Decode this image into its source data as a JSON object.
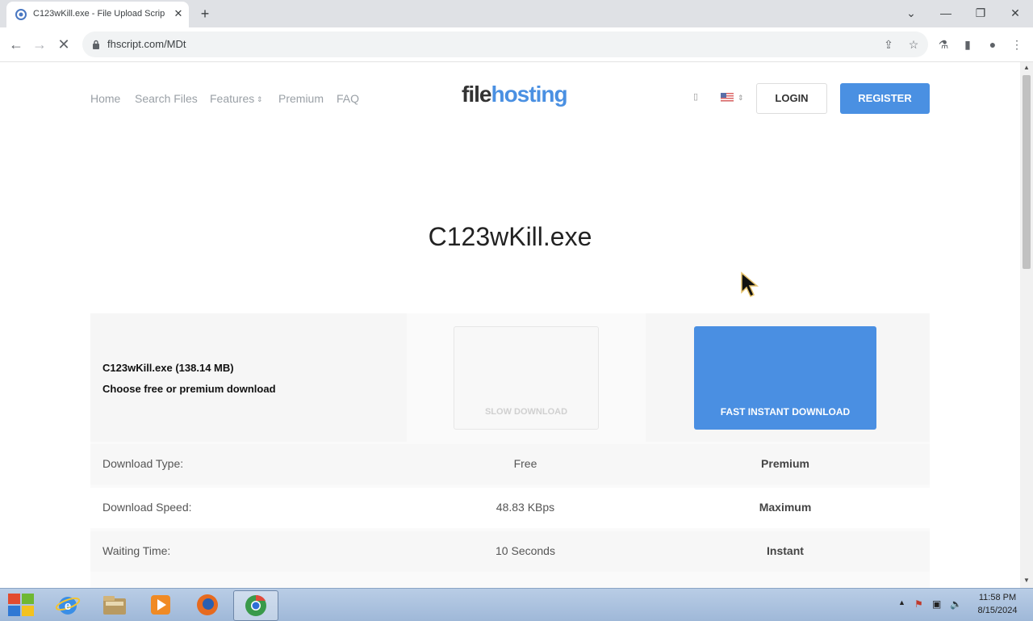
{
  "browser": {
    "tab_title": "C123wKill.exe - File Upload Script",
    "tab_close": "✕",
    "new_tab": "+",
    "url": "fhscript.com/MDt",
    "window_controls": {
      "dropdown": "⌄",
      "minimize": "—",
      "restore": "❐",
      "close": "✕"
    }
  },
  "site": {
    "nav": [
      "Home",
      "Search Files",
      "Features",
      "Premium",
      "FAQ"
    ],
    "logo_part1": "file",
    "logo_part2": "hosting",
    "login": "LOGIN",
    "register": "REGISTER",
    "brand_color": "#4a90e2"
  },
  "file": {
    "title": "C123wKill.exe",
    "name_size": "C123wKill.exe (138.14 MB)",
    "choose": "Choose free or premium download",
    "slow_download": "SLOW DOWNLOAD",
    "fast_download": "FAST INSTANT DOWNLOAD"
  },
  "table": {
    "rows": [
      {
        "label": "Download Type:",
        "free": "Free",
        "premium": "Premium"
      },
      {
        "label": "Download Speed:",
        "free": "48.83 KBps",
        "premium": "Maximum"
      },
      {
        "label": "Waiting Time:",
        "free": "10 Seconds",
        "premium": "Instant"
      }
    ]
  },
  "taskbar": {
    "time": "11:58 PM",
    "date": "8/15/2024"
  }
}
